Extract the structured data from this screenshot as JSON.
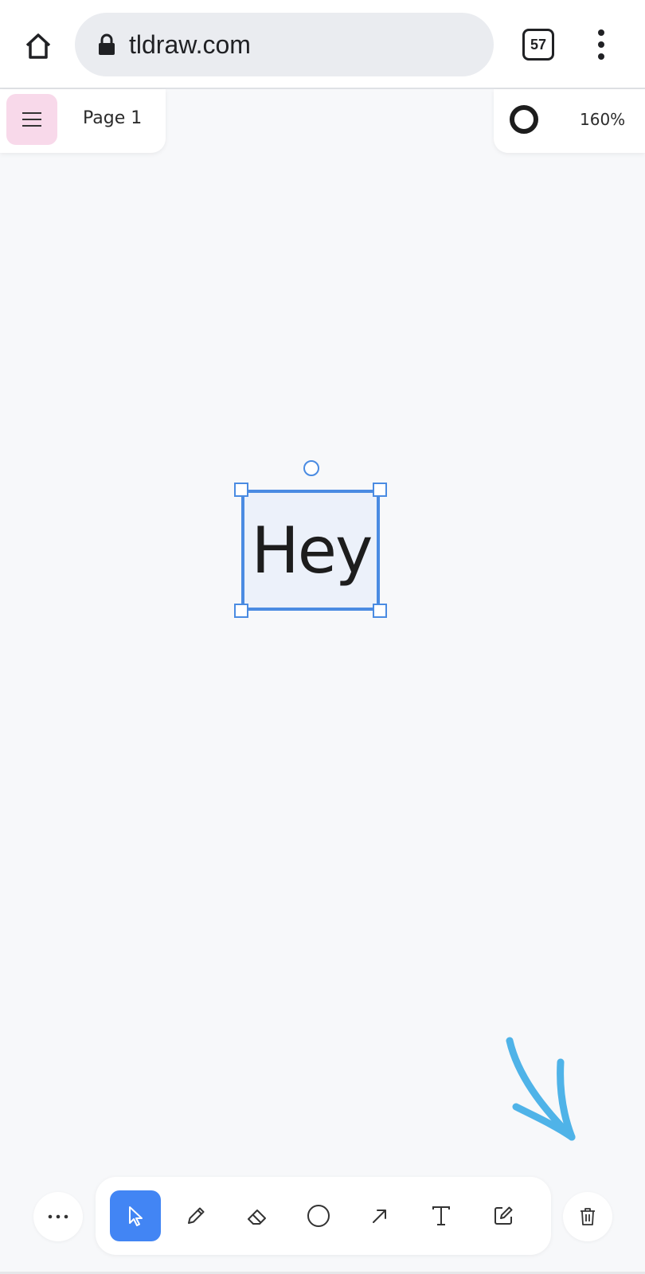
{
  "browser": {
    "url": "tldraw.com",
    "tab_count": "57"
  },
  "header": {
    "page_name": "Page 1",
    "zoom": "160%"
  },
  "canvas": {
    "text_shape": "Hey",
    "selection_color": "#4a8be2",
    "arrow_color": "#4fb3e8"
  },
  "toolbar": {
    "tools": [
      {
        "id": "select",
        "icon": "cursor-icon",
        "active": true
      },
      {
        "id": "draw",
        "icon": "pencil-icon",
        "active": false
      },
      {
        "id": "eraser",
        "icon": "eraser-icon",
        "active": false
      },
      {
        "id": "ellipse",
        "icon": "circle-icon",
        "active": false
      },
      {
        "id": "arrow",
        "icon": "arrow-icon",
        "active": false
      },
      {
        "id": "text",
        "icon": "text-icon",
        "active": false
      },
      {
        "id": "note",
        "icon": "note-icon",
        "active": false
      }
    ],
    "accent_color": "#4285f4"
  },
  "colors": {
    "menu_button_bg": "#f8d9ea",
    "canvas_bg": "#f7f8fa"
  }
}
